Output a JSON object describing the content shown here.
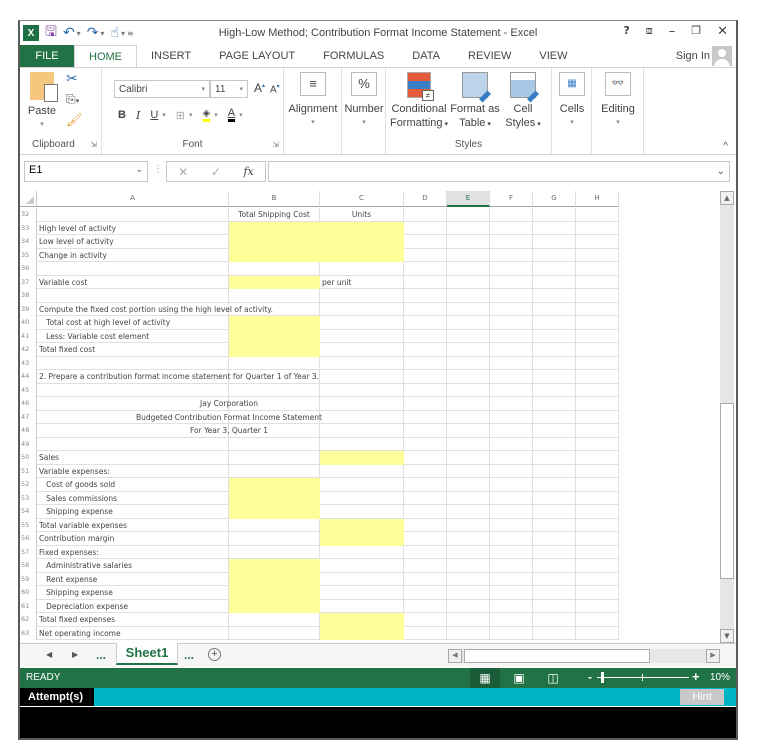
{
  "window": {
    "title": "High-Low Method; Contribution Format Income Statement - Excel",
    "controls": {
      "help": "?",
      "ribbon_display": "⧈",
      "minimize": "–",
      "restore": "❐",
      "close": "✕"
    }
  },
  "qat": {
    "app_icon": "X",
    "save_icon": "save-icon",
    "undo_icon": "undo-icon",
    "redo_icon": "redo-icon",
    "touch_icon": "touch-mode-icon"
  },
  "tabs": [
    {
      "label": "FILE"
    },
    {
      "label": "HOME"
    },
    {
      "label": "INSERT"
    },
    {
      "label": "PAGE LAYOUT"
    },
    {
      "label": "FORMULAS"
    },
    {
      "label": "DATA"
    },
    {
      "label": "REVIEW"
    },
    {
      "label": "VIEW"
    }
  ],
  "sign_in": "Sign In",
  "ribbon": {
    "clipboard": {
      "label": "Clipboard",
      "paste": "Paste"
    },
    "font": {
      "label": "Font",
      "name": "Calibri",
      "size": "11",
      "bold": "B",
      "italic": "I",
      "underline": "U",
      "font_color_letter": "A"
    },
    "alignment": {
      "label": "Alignment"
    },
    "number": {
      "label": "Number",
      "icon": "%"
    },
    "styles": {
      "label": "Styles",
      "conditional_1": "Conditional",
      "conditional_2": "Formatting",
      "format_table_1": "Format as",
      "format_table_2": "Table",
      "cell_styles_1": "Cell",
      "cell_styles_2": "Styles"
    },
    "cells": {
      "label": "Cells"
    },
    "editing": {
      "label": "Editing"
    }
  },
  "formula_bar": {
    "name_box": "E1",
    "fx": "fx",
    "formula": ""
  },
  "columns": [
    "A",
    "B",
    "C",
    "D",
    "E",
    "F",
    "G",
    "H"
  ],
  "selected_column": "E",
  "rows": [
    {
      "n": "32",
      "a": "",
      "b": "Total Shipping Cost",
      "c": "Units"
    },
    {
      "n": "33",
      "a": "High level of activity",
      "b": "",
      "c": ""
    },
    {
      "n": "34",
      "a": "Low level of activity",
      "b": "",
      "c": ""
    },
    {
      "n": "35",
      "a": "Change in activity",
      "b": "",
      "c": ""
    },
    {
      "n": "36",
      "a": "",
      "b": "",
      "c": ""
    },
    {
      "n": "37",
      "a": "Variable cost",
      "b": "",
      "c": "per unit"
    },
    {
      "n": "38",
      "a": "",
      "b": "",
      "c": ""
    },
    {
      "n": "39",
      "a": "Compute the fixed cost portion using the high level of activity.",
      "b": "",
      "c": ""
    },
    {
      "n": "40",
      "a": "   Total cost at high level of activity",
      "b": "",
      "c": ""
    },
    {
      "n": "41",
      "a": "   Less: Variable cost element",
      "b": "",
      "c": ""
    },
    {
      "n": "42",
      "a": "Total fixed cost",
      "b": "",
      "c": ""
    },
    {
      "n": "43",
      "a": "",
      "b": "",
      "c": ""
    },
    {
      "n": "44",
      "a": "2. Prepare a contribution format income statement for Quarter 1 of Year 3.",
      "b": "",
      "c": ""
    },
    {
      "n": "45",
      "a": "",
      "b": "",
      "c": ""
    },
    {
      "n": "46",
      "a": "",
      "b": "",
      "c": "",
      "span": "Jay Corporation"
    },
    {
      "n": "47",
      "a": "",
      "b": "",
      "c": "",
      "span": "Budgeted Contribution Format Income Statement"
    },
    {
      "n": "48",
      "a": "",
      "b": "",
      "c": "",
      "span": "For Year 3, Quarter 1"
    },
    {
      "n": "49",
      "a": "",
      "b": "",
      "c": ""
    },
    {
      "n": "50",
      "a": "Sales",
      "b": "",
      "c": ""
    },
    {
      "n": "51",
      "a": "Variable expenses:",
      "b": "",
      "c": ""
    },
    {
      "n": "52",
      "a": "   Cost of goods sold",
      "b": "",
      "c": ""
    },
    {
      "n": "53",
      "a": "   Sales commissions",
      "b": "",
      "c": ""
    },
    {
      "n": "54",
      "a": "   Shipping expense",
      "b": "",
      "c": ""
    },
    {
      "n": "55",
      "a": "Total variable expenses",
      "b": "",
      "c": ""
    },
    {
      "n": "56",
      "a": "Contribution margin",
      "b": "",
      "c": ""
    },
    {
      "n": "57",
      "a": "Fixed expenses:",
      "b": "",
      "c": ""
    },
    {
      "n": "58",
      "a": "   Administrative salaries",
      "b": "",
      "c": ""
    },
    {
      "n": "59",
      "a": "   Rent expense",
      "b": "",
      "c": ""
    },
    {
      "n": "60",
      "a": "   Shipping expense",
      "b": "",
      "c": ""
    },
    {
      "n": "61",
      "a": "   Depreciation expense",
      "b": "",
      "c": ""
    },
    {
      "n": "62",
      "a": "Total fixed expenses",
      "b": "",
      "c": ""
    },
    {
      "n": "63",
      "a": "Net operating income",
      "b": "",
      "c": ""
    }
  ],
  "input_cells": {
    "B": [
      "33",
      "34",
      "35",
      "37",
      "40",
      "41",
      "42",
      "52",
      "53",
      "54",
      "58",
      "59",
      "60",
      "61"
    ],
    "C": [
      "33",
      "34",
      "35",
      "50",
      "55",
      "56",
      "62",
      "63"
    ]
  },
  "input_color": "#ffff99",
  "sheet_tabs": {
    "ellipsis": "...",
    "active": "Sheet1",
    "add": "+"
  },
  "status": {
    "mode": "READY",
    "zoom": "10%",
    "zoom_fraction": 0.1
  },
  "attempt": {
    "label": "Attempt(s)",
    "hint": "Hint"
  },
  "colors": {
    "excel_green": "#217346",
    "attempt_bar": "#00b4c6"
  }
}
